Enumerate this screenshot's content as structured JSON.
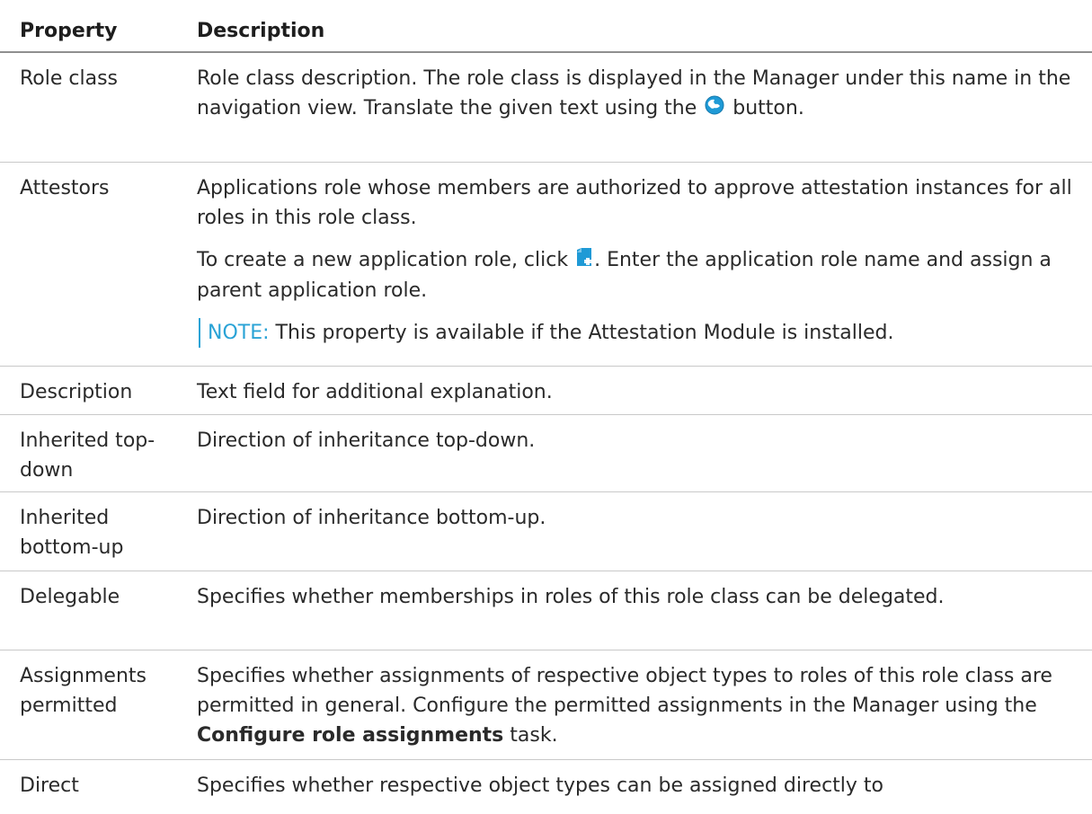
{
  "header": {
    "property": "Property",
    "description": "Description"
  },
  "rows": {
    "role_class": {
      "property": "Role class",
      "desc_before": "Role class description. The role class is displayed in the Manager under this name in the navigation view. Translate the given text using the",
      "desc_after": "button.",
      "icon": "globe-translate-icon"
    },
    "attestors": {
      "property": "Attestors",
      "para1": "Applications role whose members are authorized to approve attestation instances for all roles in this role class.",
      "para2_before": "To create a new application role, click",
      "para2_after": ". Enter the application role name and assign a parent application role.",
      "icon": "new-document-icon",
      "note_label": "NOTE:",
      "note_text": " This property is available if the Attestation Module is installed."
    },
    "description": {
      "property": "Description",
      "desc": "Text field for additional explanation."
    },
    "inherited_top_down": {
      "property": "Inherited top-down",
      "desc": "Direction of inheritance top-down."
    },
    "inherited_bottom_up": {
      "property": "Inherited bottom-up",
      "desc": "Direction of inheritance bottom-up."
    },
    "delegable": {
      "property": "Delegable",
      "desc": "Specifies whether memberships in roles of this role class can be delegated."
    },
    "assignments_permitted": {
      "property": "Assignments permitted",
      "desc_before": "Specifies whether assignments of respective object types to roles of this role class are permitted in general. Configure the permitted assignments in the Manager using the",
      "desc_bold": "Configure role assignments",
      "desc_after": "task."
    },
    "direct": {
      "property": "Direct",
      "desc": "Specifies whether respective object types can be assigned directly to"
    }
  },
  "colors": {
    "note_accent": "#2aa3d6",
    "icon_blue": "#1f9ad6"
  }
}
